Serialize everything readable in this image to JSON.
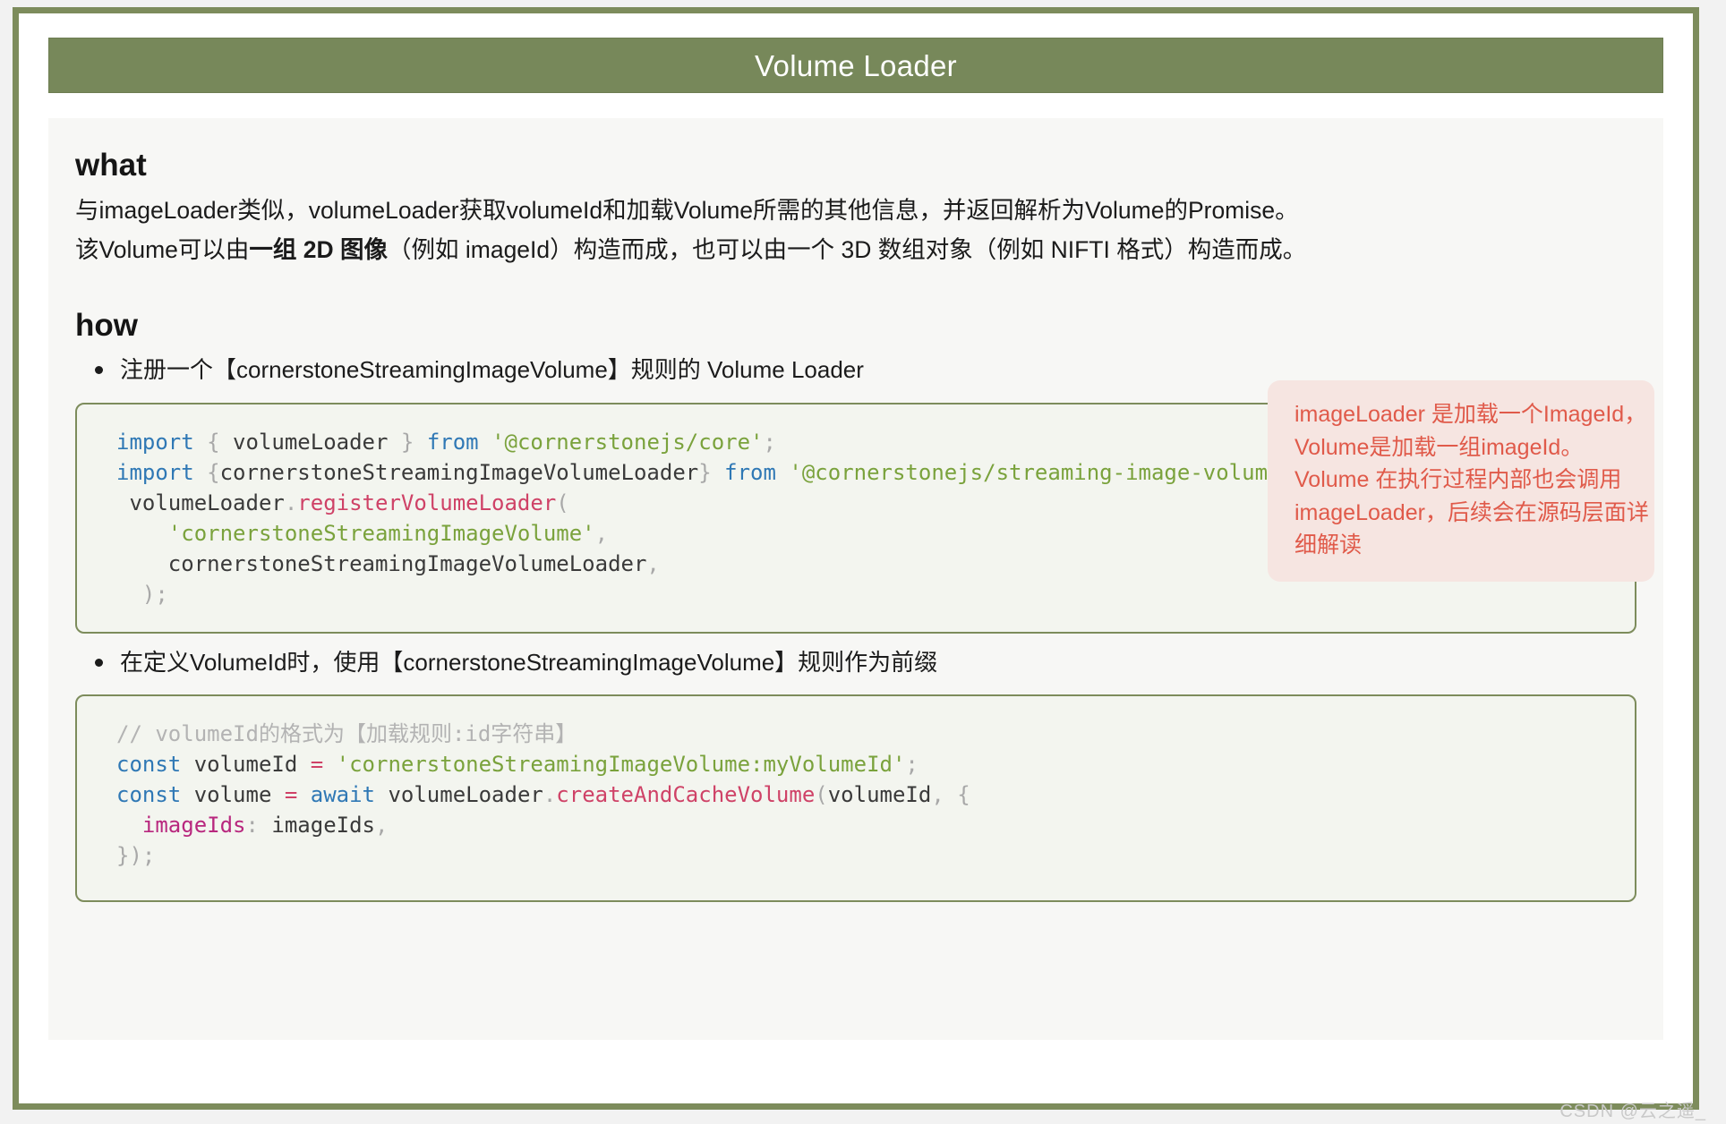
{
  "slide": {
    "title": "Volume Loader"
  },
  "what": {
    "heading": "what",
    "line1_a": "与imageLoader类似，volumeLoader获取volumeId和加载Volume所需的其他信息，并返回解析为Volume的Promise。",
    "line2_a": "该Volume可以由",
    "line2_bold": "一组 2D 图像",
    "line2_b": "（例如 imageId）构造而成，也可以由一个 3D 数组对象（例如 NIFTI 格式）构造而成。"
  },
  "how": {
    "heading": "how",
    "bullets": [
      "注册一个【cornerstoneStreamingImageVolume】规则的 Volume Loader",
      "在定义VolumeId时，使用【cornerstoneStreamingImageVolume】规则作为前缀"
    ]
  },
  "code_block_1": {
    "lines": [
      {
        "tokens": [
          {
            "t": "import",
            "c": "kw"
          },
          {
            "t": " ",
            "c": "plain"
          },
          {
            "t": "{",
            "c": "punct"
          },
          {
            "t": " volumeLoader ",
            "c": "plain"
          },
          {
            "t": "}",
            "c": "punct"
          },
          {
            "t": " ",
            "c": "plain"
          },
          {
            "t": "from",
            "c": "kw"
          },
          {
            "t": " ",
            "c": "plain"
          },
          {
            "t": "'@cornerstonejs/core'",
            "c": "str"
          },
          {
            "t": ";",
            "c": "punct"
          }
        ]
      },
      {
        "tokens": [
          {
            "t": "import",
            "c": "kw"
          },
          {
            "t": " ",
            "c": "plain"
          },
          {
            "t": "{",
            "c": "punct"
          },
          {
            "t": "cornerstoneStreamingImageVolumeLoader",
            "c": "plain"
          },
          {
            "t": "}",
            "c": "punct"
          },
          {
            "t": " ",
            "c": "plain"
          },
          {
            "t": "from",
            "c": "kw"
          },
          {
            "t": " ",
            "c": "plain"
          },
          {
            "t": "'@cornerstonejs/streaming-image-volume-loader'",
            "c": "str"
          },
          {
            "t": ";",
            "c": "punct"
          }
        ]
      },
      {
        "tokens": [
          {
            "t": " volumeLoader",
            "c": "plain"
          },
          {
            "t": ".",
            "c": "punct"
          },
          {
            "t": "registerVolumeLoader",
            "c": "fn"
          },
          {
            "t": "(",
            "c": "punct"
          }
        ]
      },
      {
        "tokens": [
          {
            "t": "    ",
            "c": "plain"
          },
          {
            "t": "'cornerstoneStreamingImageVolume'",
            "c": "str"
          },
          {
            "t": ",",
            "c": "punct"
          }
        ]
      },
      {
        "tokens": [
          {
            "t": "    cornerstoneStreamingImageVolumeLoader",
            "c": "plain"
          },
          {
            "t": ",",
            "c": "punct"
          }
        ]
      },
      {
        "tokens": [
          {
            "t": "  ",
            "c": "plain"
          },
          {
            "t": ");",
            "c": "punct"
          }
        ]
      }
    ]
  },
  "code_block_2": {
    "lines": [
      {
        "tokens": [
          {
            "t": "// volumeId的格式为【加载规则:id字符串】",
            "c": "comment"
          }
        ]
      },
      {
        "tokens": [
          {
            "t": "const",
            "c": "kw"
          },
          {
            "t": " volumeId ",
            "c": "plain"
          },
          {
            "t": "=",
            "c": "op"
          },
          {
            "t": " ",
            "c": "plain"
          },
          {
            "t": "'cornerstoneStreamingImageVolume:myVolumeId'",
            "c": "str"
          },
          {
            "t": ";",
            "c": "punct"
          }
        ]
      },
      {
        "tokens": [
          {
            "t": "const",
            "c": "kw"
          },
          {
            "t": " volume ",
            "c": "plain"
          },
          {
            "t": "=",
            "c": "op"
          },
          {
            "t": " ",
            "c": "plain"
          },
          {
            "t": "await",
            "c": "kw"
          },
          {
            "t": " volumeLoader",
            "c": "plain"
          },
          {
            "t": ".",
            "c": "punct"
          },
          {
            "t": "createAndCacheVolume",
            "c": "fn"
          },
          {
            "t": "(",
            "c": "punct"
          },
          {
            "t": "volumeId",
            "c": "plain"
          },
          {
            "t": ",",
            "c": "punct"
          },
          {
            "t": " ",
            "c": "plain"
          },
          {
            "t": "{",
            "c": "punct"
          }
        ]
      },
      {
        "tokens": [
          {
            "t": "  ",
            "c": "plain"
          },
          {
            "t": "imageIds",
            "c": "prop"
          },
          {
            "t": ":",
            "c": "punct"
          },
          {
            "t": " imageIds",
            "c": "plain"
          },
          {
            "t": ",",
            "c": "punct"
          }
        ]
      },
      {
        "tokens": [
          {
            "t": "});",
            "c": "punct"
          }
        ]
      }
    ]
  },
  "callout": {
    "lines": [
      "imageLoader 是加载一个ImageId，",
      "Volume是加载一组imageId。",
      "Volume 在执行过程内部也会调用",
      "imageLoader，后续会在源码层面详",
      "细解读"
    ]
  },
  "watermark": {
    "text": "CSDN @云之遥_"
  },
  "colors": {
    "frame_green": "#7d8c5c",
    "header_green": "#77885a",
    "panel_bg": "#f7f7f5",
    "code_bg": "#f3f5ef",
    "callout_bg": "#f6e5e1",
    "callout_text": "#e05a4a"
  }
}
